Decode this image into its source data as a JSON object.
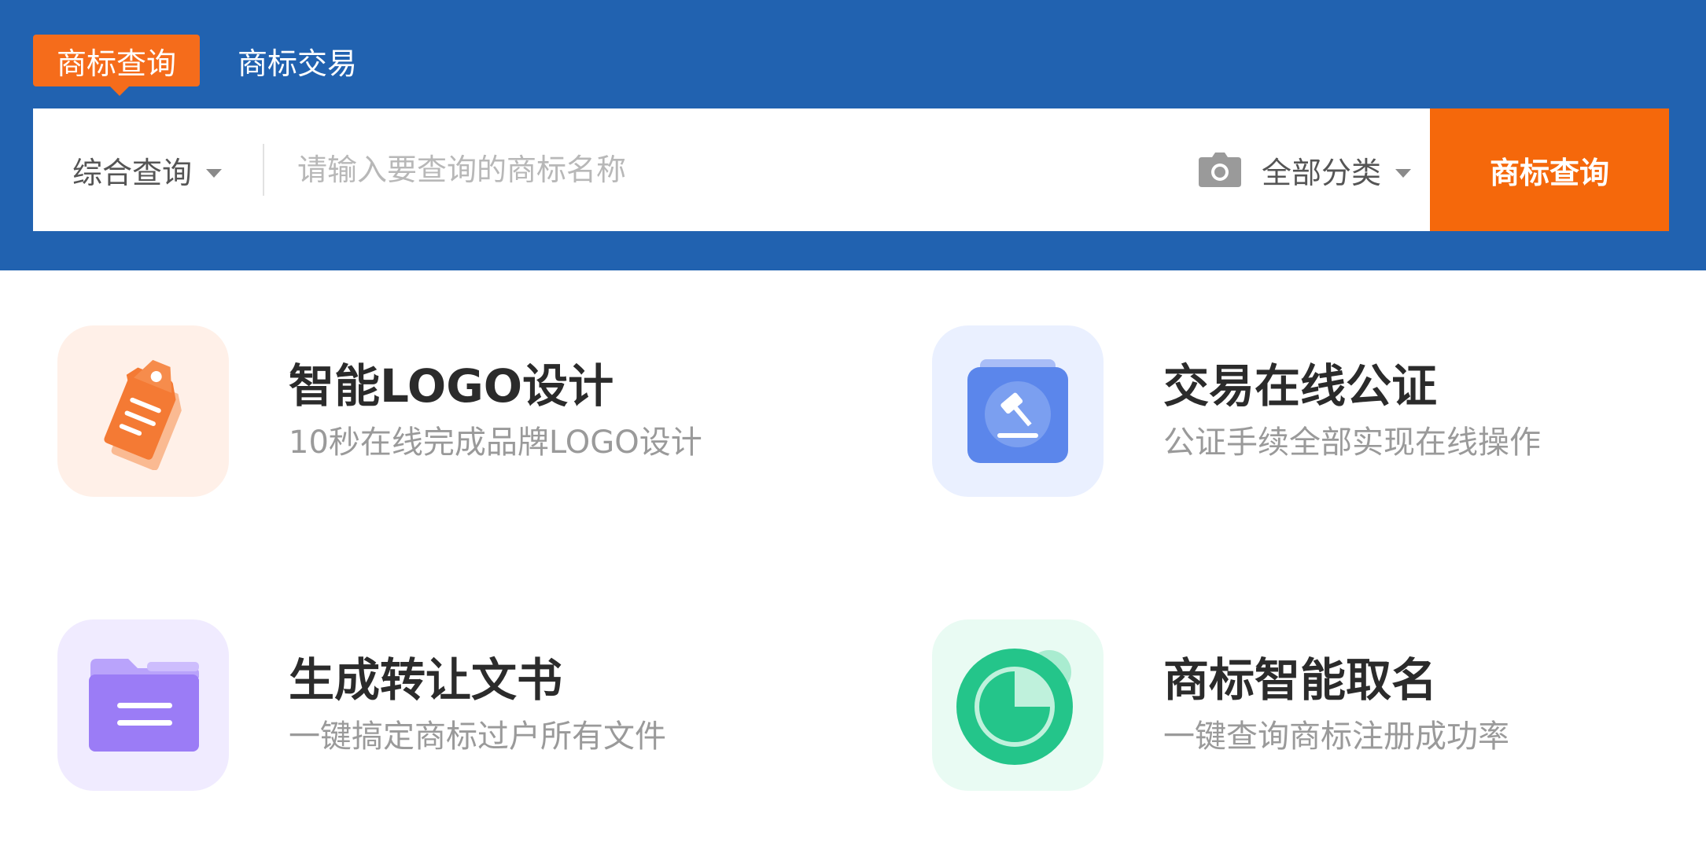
{
  "tabs": [
    {
      "label": "商标查询",
      "active": true
    },
    {
      "label": "商标交易",
      "active": false
    }
  ],
  "search": {
    "mode_label": "综合查询",
    "placeholder": "请输入要查询的商标名称",
    "value": "",
    "category_label": "全部分类",
    "button_label": "商标查询"
  },
  "features": [
    {
      "title": "智能LOGO设计",
      "desc": "10秒在线完成品牌LOGO设计",
      "icon": "price-tag-icon"
    },
    {
      "title": "交易在线公证",
      "desc": "公证手续全部实现在线操作",
      "icon": "gavel-icon"
    },
    {
      "title": "生成转让文书",
      "desc": "一键搞定商标过户所有文件",
      "icon": "folder-icon"
    },
    {
      "title": "商标智能取名",
      "desc": "一键查询商标注册成功率",
      "icon": "pie-chart-icon"
    }
  ],
  "colors": {
    "header_bg": "#2162b0",
    "accent_orange": "#f5680b",
    "title_text": "#2b2b2b",
    "desc_text": "#9a9a9a"
  }
}
